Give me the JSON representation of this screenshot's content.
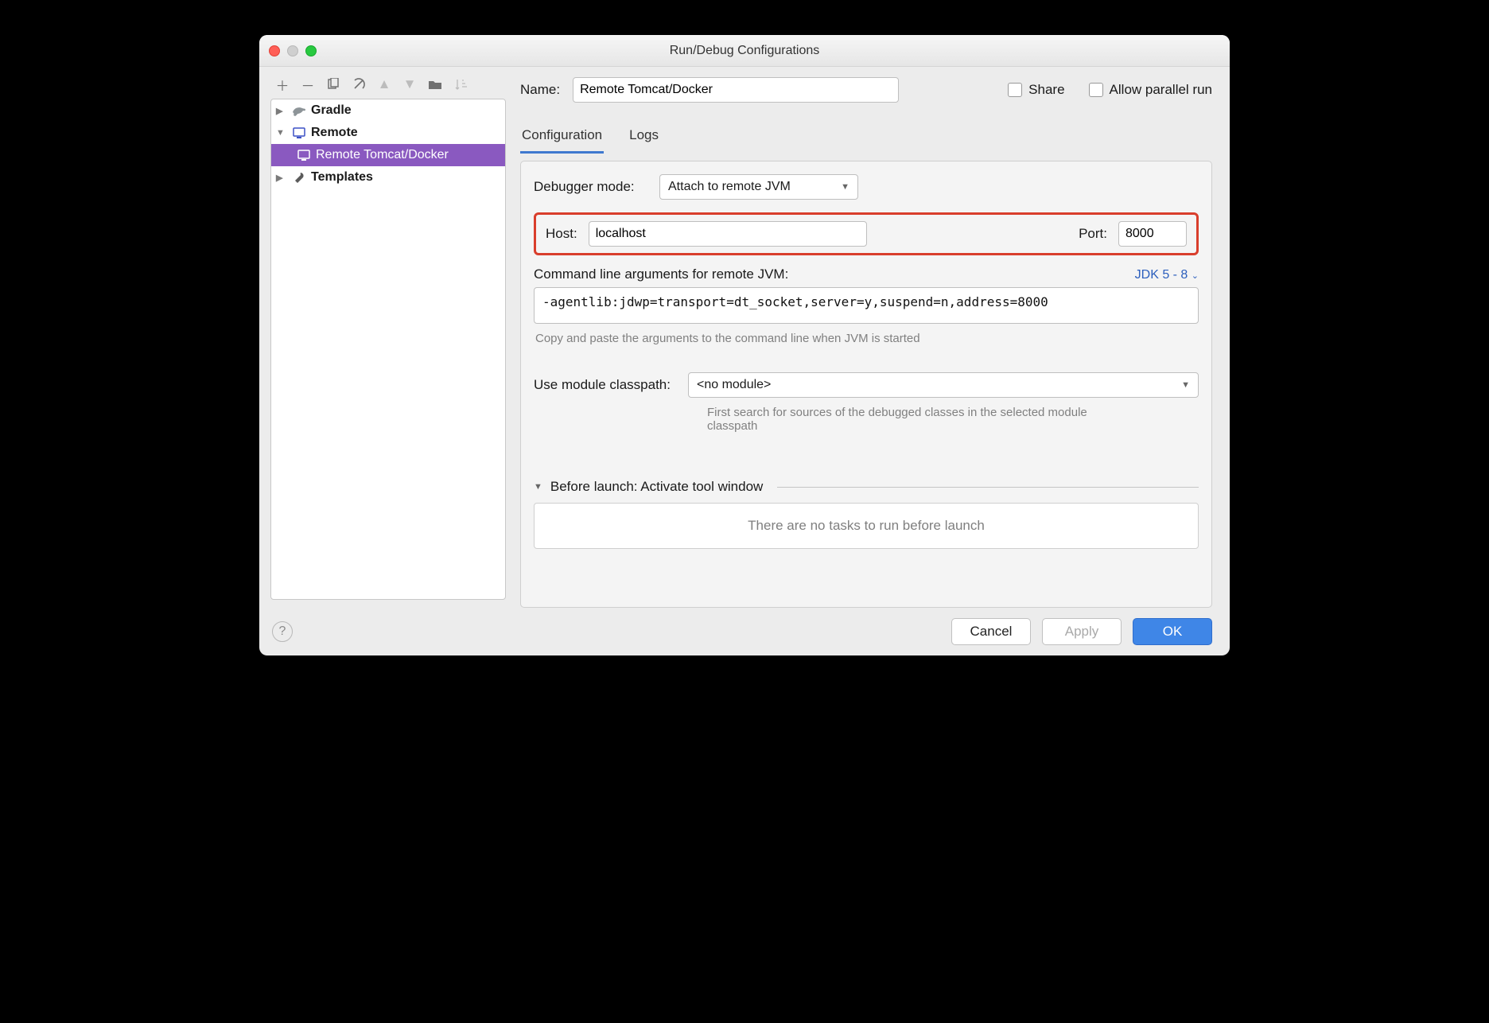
{
  "window": {
    "title": "Run/Debug Configurations"
  },
  "tree": {
    "items": [
      {
        "label": "Gradle"
      },
      {
        "label": "Remote"
      },
      {
        "label": "Remote Tomcat/Docker"
      },
      {
        "label": "Templates"
      }
    ]
  },
  "form": {
    "name_label": "Name:",
    "name_value": "Remote Tomcat/Docker",
    "share_label": "Share",
    "parallel_label": "Allow parallel run",
    "tabs": {
      "configuration": "Configuration",
      "logs": "Logs"
    },
    "debugger_mode_label": "Debugger mode:",
    "debugger_mode_value": "Attach to remote JVM",
    "host_label": "Host:",
    "host_value": "localhost",
    "port_label": "Port:",
    "port_value": "8000",
    "cmdline_label": "Command line arguments for remote JVM:",
    "jdk_label": "JDK 5 - 8",
    "cmdline_value": "-agentlib:jdwp=transport=dt_socket,server=y,suspend=n,address=8000",
    "cmdline_hint": "Copy and paste the arguments to the command line when JVM is started",
    "module_label": "Use module classpath:",
    "module_value": "<no module>",
    "module_hint": "First search for sources of the debugged classes in the selected module classpath",
    "before_launch_label": "Before launch: Activate tool window",
    "before_launch_empty": "There are no tasks to run before launch"
  },
  "footer": {
    "cancel": "Cancel",
    "apply": "Apply",
    "ok": "OK"
  }
}
